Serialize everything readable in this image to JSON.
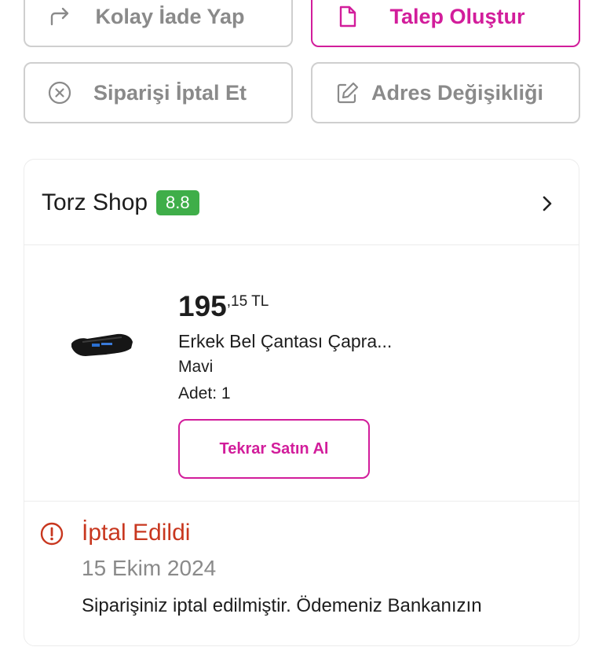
{
  "actions": {
    "return_label": "Kolay İade Yap",
    "request_label": "Talep Oluştur",
    "cancel_label": "Siparişi İptal Et",
    "address_label": "Adres Değişikliği"
  },
  "store": {
    "name": "Torz Shop",
    "rating": "8.8",
    "rating_color": "#3fae49"
  },
  "product": {
    "price_whole": "195",
    "price_fraction": ",15 TL",
    "name": "Erkek Bel Çantası Çapra...",
    "color": "Mavi",
    "quantity": "Adet: 1",
    "rebuy_label": "Tekrar Satın Al"
  },
  "status": {
    "title": "İptal Edildi",
    "date": "15 Ekim 2024",
    "description": "Siparişiniz iptal edilmiştir. Ödemeniz Bankanızın",
    "color": "#c8371f"
  },
  "theme": {
    "accent": "#d21d9b",
    "border": "#cfcfcf"
  },
  "icons": [
    "return-arrow-icon",
    "document-icon",
    "cancel-circle-icon",
    "edit-icon",
    "chevron-right-icon",
    "alert-circle-icon"
  ]
}
